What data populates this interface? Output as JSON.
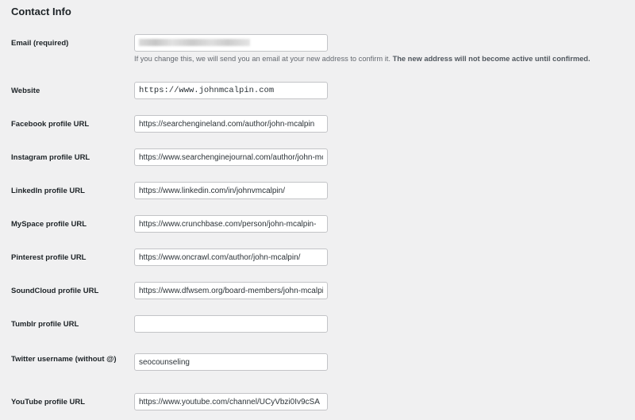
{
  "section": {
    "title": "Contact Info"
  },
  "fields": [
    {
      "id": "email",
      "label": "Email (required)",
      "value": "",
      "redacted": true,
      "description": "If you change this, we will send you an email at your new address to confirm it. ",
      "description_strong": "The new address will not become active until confirmed."
    },
    {
      "id": "website",
      "label": "Website",
      "value": "https://www.johnmcalpin.com"
    },
    {
      "id": "facebook",
      "label": "Facebook profile URL",
      "value": "https://searchengineland.com/author/john-mcalpin"
    },
    {
      "id": "instagram",
      "label": "Instagram profile URL",
      "value": "https://www.searchenginejournal.com/author/john-mcalpin/"
    },
    {
      "id": "linkedin",
      "label": "LinkedIn profile URL",
      "value": "https://www.linkedin.com/in/johnvmcalpin/"
    },
    {
      "id": "myspace",
      "label": "MySpace profile URL",
      "value": "https://www.crunchbase.com/person/john-mcalpin-"
    },
    {
      "id": "pinterest",
      "label": "Pinterest profile URL",
      "value": "https://www.oncrawl.com/author/john-mcalpin/"
    },
    {
      "id": "soundcloud",
      "label": "SoundCloud profile URL",
      "value": "https://www.dfwsem.org/board-members/john-mcalpin"
    },
    {
      "id": "tumblr",
      "label": "Tumblr profile URL",
      "value": ""
    },
    {
      "id": "twitter",
      "label": "Twitter username (without @)",
      "value": "seocounseling"
    },
    {
      "id": "youtube",
      "label": "YouTube profile URL",
      "value": "https://www.youtube.com/channel/UCyVbzi0Iv9cSA"
    }
  ]
}
